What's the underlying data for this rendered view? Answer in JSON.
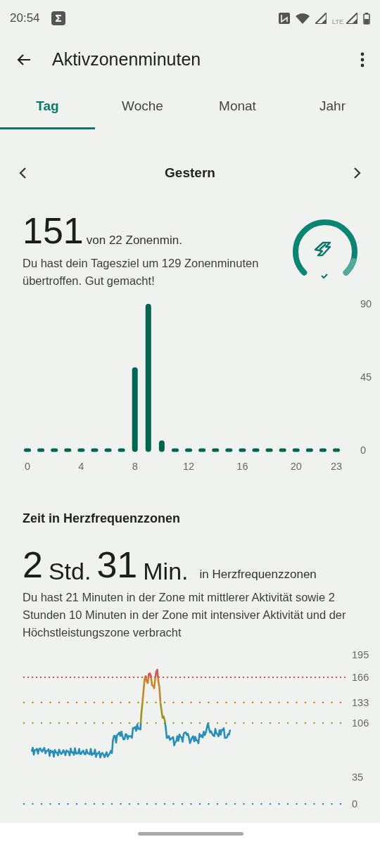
{
  "status_bar": {
    "time": "20:54",
    "network": "LTE"
  },
  "app_bar": {
    "title": "Aktivzonenminuten"
  },
  "tabs": [
    {
      "label": "Tag",
      "selected": true
    },
    {
      "label": "Woche",
      "selected": false
    },
    {
      "label": "Monat",
      "selected": false
    },
    {
      "label": "Jahr",
      "selected": false
    }
  ],
  "date_nav": {
    "label": "Gestern"
  },
  "summary": {
    "value": "151",
    "unit": "von 22 Zonenmin.",
    "description": "Du hast dein Tagesziel um 129 Zonenminuten übertroffen. Gut gemacht!"
  },
  "chart_data": {
    "type": "bar",
    "x": [
      0,
      1,
      2,
      3,
      4,
      5,
      6,
      7,
      8,
      9,
      10,
      11,
      12,
      13,
      14,
      15,
      16,
      17,
      18,
      19,
      20,
      21,
      22,
      23
    ],
    "values": [
      0,
      0,
      0,
      0,
      0,
      0,
      0,
      0,
      51,
      90,
      6,
      0,
      0,
      0,
      0,
      0,
      0,
      0,
      0,
      0,
      0,
      0,
      0,
      0
    ],
    "xlim": [
      0,
      23
    ],
    "xticks": [
      0,
      4,
      8,
      12,
      16,
      20,
      23
    ],
    "yticks": [
      0,
      45,
      90
    ],
    "ylim": [
      0,
      90
    ]
  },
  "heart_zones": {
    "heading": "Zeit in Herzfrequenzzonen",
    "hours": "2",
    "hours_unit": "Std.",
    "minutes": "31",
    "minutes_unit": "Min.",
    "suffix": "in Herzfrequenzzonen",
    "description": "Du hast 21 Minuten in der Zone mit mittlerer Aktivität sowie 2 Stunden 10 Minuten in der Zone mit intensiver Aktivität und der Höchstleistungszone verbracht",
    "y_labels": [
      "195",
      "166",
      "133",
      "106",
      "35",
      "0"
    ]
  }
}
